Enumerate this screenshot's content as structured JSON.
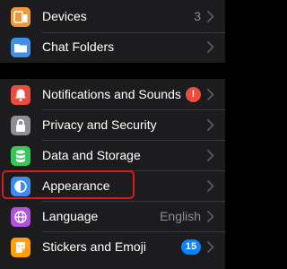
{
  "group1": {
    "items": [
      {
        "label": "Devices",
        "value": "3",
        "icon": "laptop-phone-icon",
        "icon_color": "#f09a37"
      },
      {
        "label": "Chat Folders",
        "icon": "folder-icon",
        "icon_color": "#3e90e8"
      }
    ]
  },
  "group2": {
    "items": [
      {
        "label": "Notifications and Sounds",
        "badge": "!",
        "badge_color": "#eb4d3d",
        "icon": "bell-icon",
        "icon_color": "#eb4d3d"
      },
      {
        "label": "Privacy and Security",
        "icon": "lock-icon",
        "icon_color": "#8e8e93"
      },
      {
        "label": "Data and Storage",
        "icon": "database-icon",
        "icon_color": "#34c759"
      },
      {
        "label": "Appearance",
        "icon": "half-circle-icon",
        "icon_color": "#3a8ef0"
      },
      {
        "label": "Language",
        "value": "English",
        "icon": "globe-icon",
        "icon_color": "#af52de"
      },
      {
        "label": "Stickers and Emoji",
        "badge": "15",
        "badge_color": "#0a84ff",
        "icon": "sticker-icon",
        "icon_color": "#ff9f0a"
      }
    ]
  },
  "colors": {
    "background": "#000000",
    "cell": "#1c1c1e",
    "separator": "#38383a",
    "secondary_text": "#8e8e93",
    "highlight_border": "#d71920"
  }
}
